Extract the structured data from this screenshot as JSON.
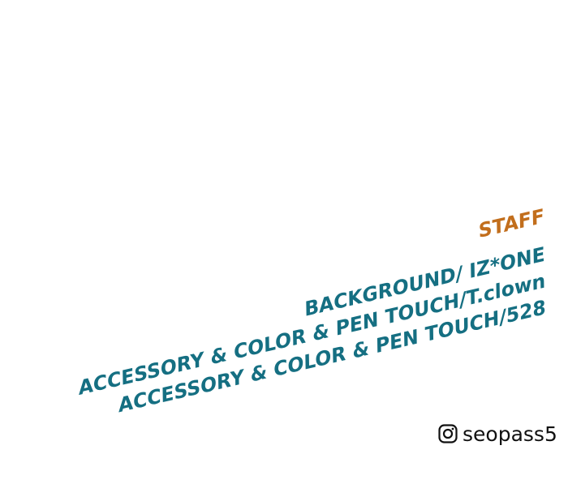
{
  "credits": {
    "heading": "STAFF",
    "lines": [
      "BACKGROUND/ IZ*ONE",
      "ACCESSORY & COLOR & PEN TOUCH/T.clown",
      "ACCESSORY & COLOR & PEN TOUCH/528"
    ]
  },
  "social": {
    "icon": "instagram-icon",
    "handle": "seopass5"
  },
  "colors": {
    "background": "#ffffff",
    "heading": "#c26e1c",
    "credit_text": "#156f82",
    "handle_text": "#111111"
  }
}
